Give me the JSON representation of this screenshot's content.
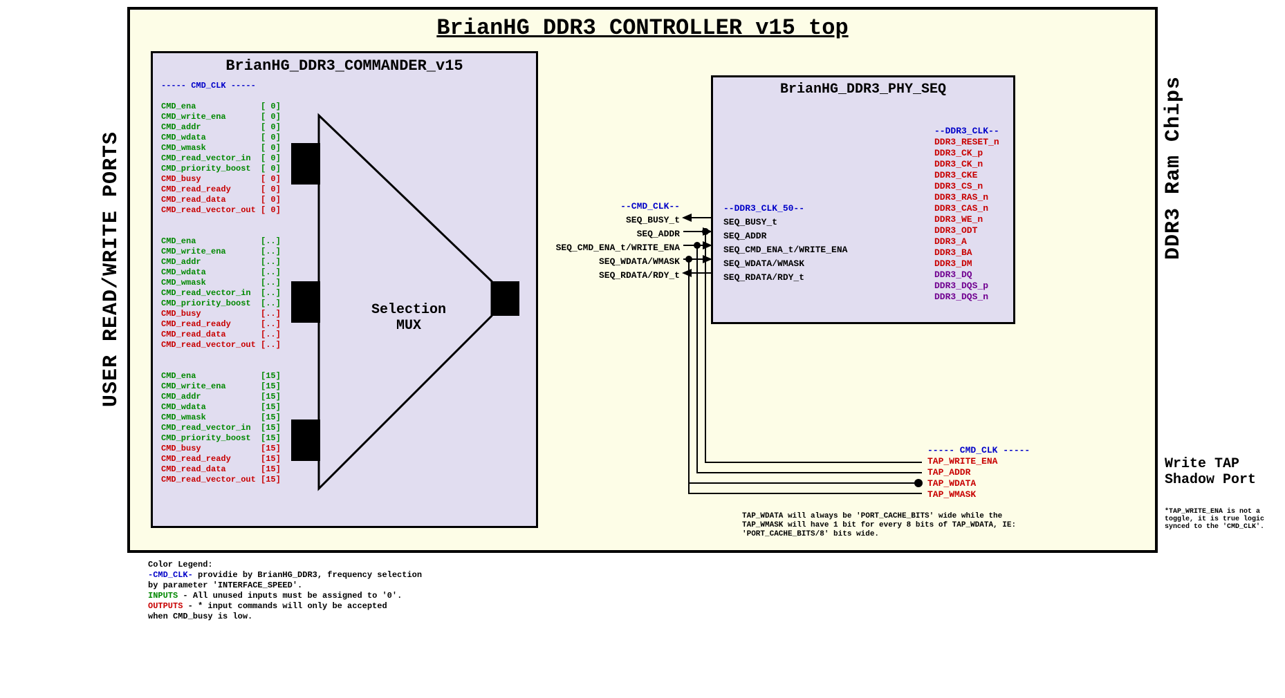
{
  "title": "BrianHG DDR3 CONTROLLER v15 top",
  "side_left": "USER READ/WRITE PORTS",
  "side_right": "DDR3 Ram Chips",
  "commander": {
    "title": "BrianHG_DDR3_COMMANDER_v15",
    "clk_header": "----- CMD_CLK -----",
    "groups": [
      {
        "idx": "[ 0]",
        "in": [
          "CMD_ena",
          "CMD_write_ena",
          "CMD_addr",
          "CMD_wdata",
          "CMD_wmask",
          "CMD_read_vector_in",
          "CMD_priority_boost"
        ],
        "out": [
          "CMD_busy",
          "CMD_read_ready",
          "CMD_read_data",
          "CMD_read_vector_out"
        ]
      },
      {
        "idx": "[..]",
        "in": [
          "CMD_ena",
          "CMD_write_ena",
          "CMD_addr",
          "CMD_wdata",
          "CMD_wmask",
          "CMD_read_vector_in",
          "CMD_priority_boost"
        ],
        "out": [
          "CMD_busy",
          "CMD_read_ready",
          "CMD_read_data",
          "CMD_read_vector_out"
        ]
      },
      {
        "idx": "[15]",
        "in": [
          "CMD_ena",
          "CMD_write_ena",
          "CMD_addr",
          "CMD_wdata",
          "CMD_wmask",
          "CMD_read_vector_in",
          "CMD_priority_boost"
        ],
        "out": [
          "CMD_busy",
          "CMD_read_ready",
          "CMD_read_data",
          "CMD_read_vector_out"
        ]
      }
    ],
    "mux_label": "Selection\nMUX"
  },
  "mid": {
    "clk": "--CMD_CLK--",
    "sigs": [
      "SEQ_BUSY_t",
      "SEQ_ADDR",
      "SEQ_CMD_ENA_t/WRITE_ENA",
      "SEQ_WDATA/WMASK",
      "SEQ_RDATA/RDY_t"
    ]
  },
  "phy": {
    "title": "BrianHG_DDR3_PHY_SEQ",
    "clk": "--DDR3_CLK_50--",
    "sigs": [
      "SEQ_BUSY_t",
      "SEQ_ADDR",
      "SEQ_CMD_ENA_t/WRITE_ENA",
      "SEQ_WDATA/WMASK",
      "SEQ_RDATA/RDY_t"
    ],
    "ddr_clk": "--DDR3_CLK--",
    "ddr_red": [
      "DDR3_RESET_n",
      "DDR3_CK_p",
      "DDR3_CK_n",
      "DDR3_CKE",
      "DDR3_CS_n",
      "DDR3_RAS_n",
      "DDR3_CAS_n",
      "DDR3_WE_n",
      "DDR3_ODT",
      "DDR3_A",
      "DDR3_BA",
      "DDR3_DM"
    ],
    "ddr_pur": [
      "DDR3_DQ",
      "DDR3_DQS_p",
      "DDR3_DQS_n"
    ]
  },
  "tap": {
    "clk": "----- CMD_CLK -----",
    "sigs": [
      "TAP_WRITE_ENA",
      "TAP_ADDR",
      "TAP_WDATA",
      "TAP_WMASK"
    ],
    "label": "Write TAP\nShadow Port",
    "note": "TAP_WDATA will always be 'PORT_CACHE_BITS' wide while the TAP_WMASK will have 1 bit for every 8 bits of TAP_WDATA, IE: 'PORT_CACHE_BITS/8' bits wide.",
    "foot": "*TAP_WRITE_ENA is not a toggle, it is true logic synced to the 'CMD_CLK'."
  },
  "legend": {
    "title": "Color Legend:",
    "l1a": "-CMD_CLK-",
    "l1b": " providie by BrianHG_DDR3, frequency selection",
    "l1c": "          by parameter 'INTERFACE_SPEED'.",
    "l2a": "INPUTS  ",
    "l2b": "- All unused inputs must be assigned to '0'.",
    "l3a": "OUTPUTS ",
    "l3b": "- * input commands will only be accepted",
    "l3c": "          when CMD_busy is low."
  }
}
